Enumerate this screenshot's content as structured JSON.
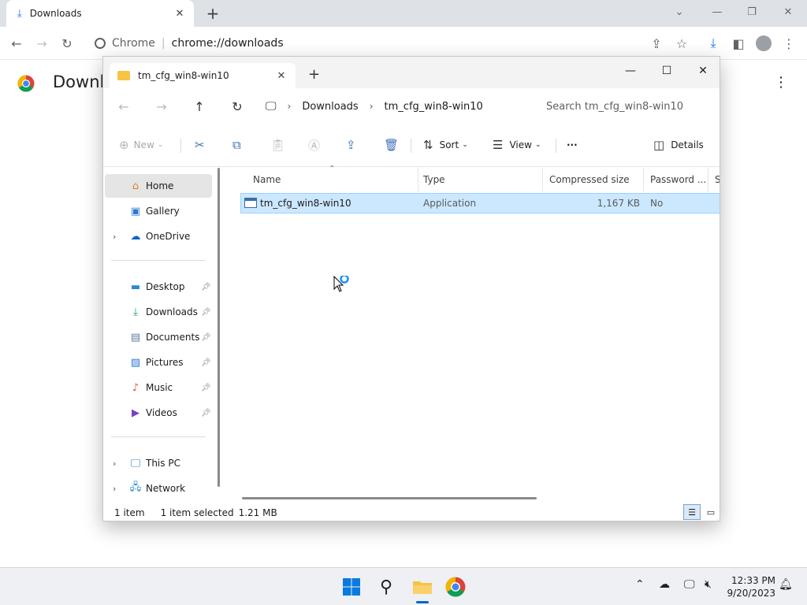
{
  "chrome": {
    "tab_title": "Downloads",
    "omnibox": {
      "site_label": "Chrome",
      "url": "chrome://downloads"
    },
    "page_heading": "Downloads",
    "menu_glyph": "⋮"
  },
  "explorer": {
    "tab_title": "tm_cfg_win8-win10",
    "breadcrumb": [
      "Downloads",
      "tm_cfg_win8-win10"
    ],
    "search_placeholder": "Search tm_cfg_win8-win10",
    "commands": {
      "new": "New",
      "sort": "Sort",
      "view": "View",
      "more": "···",
      "details": "Details"
    },
    "sidebar": {
      "home": "Home",
      "gallery": "Gallery",
      "onedrive": "OneDrive",
      "desktop": "Desktop",
      "downloads": "Downloads",
      "documents": "Documents",
      "pictures": "Pictures",
      "music": "Music",
      "videos": "Videos",
      "this_pc": "This PC",
      "network": "Network"
    },
    "columns": {
      "name": "Name",
      "type": "Type",
      "compressed_size": "Compressed size",
      "password": "Password ...",
      "size_partial": "Si"
    },
    "rows": [
      {
        "name": "tm_cfg_win8-win10",
        "type": "Application",
        "compressed_size": "1,167 KB",
        "password": "No"
      }
    ],
    "status": {
      "item_count": "1 item",
      "selection": "1 item selected",
      "selection_size": "1.21 MB"
    }
  },
  "taskbar": {
    "time": "12:33 PM",
    "date": "9/20/2023"
  },
  "colors": {
    "selection_bg": "#cce8ff",
    "selection_border": "#99d1ff",
    "accent": "#0067c0"
  }
}
